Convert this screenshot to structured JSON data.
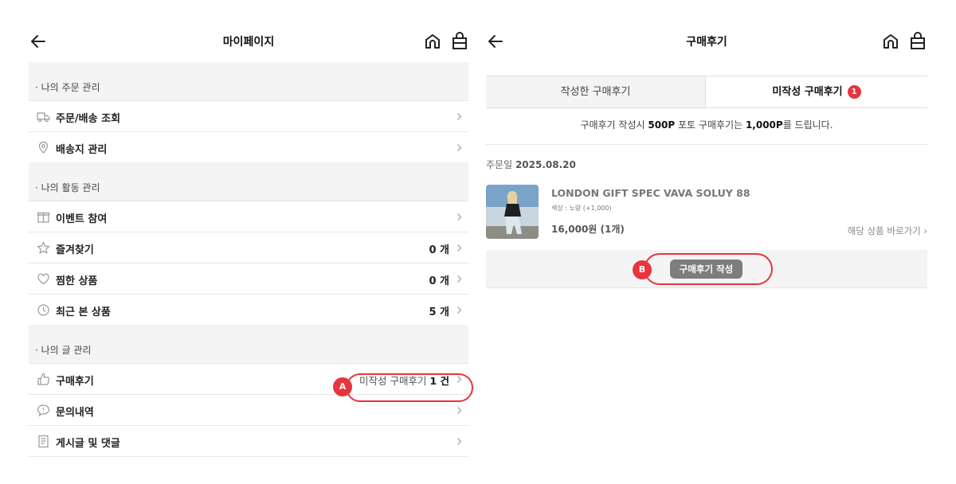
{
  "left_screen": {
    "title": "마이페이지",
    "sections": {
      "orders": {
        "heading": "· 나의 주문 관리",
        "items": [
          {
            "label": "주문/배송 조회",
            "icon": "truck-icon"
          },
          {
            "label": "배송지 관리",
            "icon": "location-pin-icon"
          }
        ]
      },
      "activity": {
        "heading": "· 나의 활동 관리",
        "items": [
          {
            "label": "이벤트 참여",
            "icon": "gift-icon"
          },
          {
            "label": "즐겨찾기",
            "icon": "star-icon",
            "value": "0 개"
          },
          {
            "label": "찜한 상품",
            "icon": "heart-icon",
            "value": "0 개"
          },
          {
            "label": "최근 본 상품",
            "icon": "clock-icon",
            "value": "5 개"
          }
        ]
      },
      "posts": {
        "heading": "· 나의 글 관리",
        "items": [
          {
            "label": "구매후기",
            "icon": "thumbs-up-icon",
            "pending_label": "미작성 구매후기",
            "pending_count": "1 건"
          },
          {
            "label": "문의내역",
            "icon": "speech-bubble-icon"
          },
          {
            "label": "게시글 및 댓글",
            "icon": "document-icon"
          }
        ]
      }
    },
    "callout_label": "A"
  },
  "right_screen": {
    "title": "구매후기",
    "tabs": {
      "written": "작성한 구매후기",
      "unwritten": "미작성 구매후기",
      "unwritten_count": "1"
    },
    "notice": {
      "part1": "구매후기 작성시 ",
      "point1": "500P",
      "part2": " 포토 구매후기는 ",
      "point2": "1,000P",
      "part3": "를 드립니다."
    },
    "order": {
      "date_label": "주문일 ",
      "date": "2025.08.20",
      "product_name": "LONDON GIFT SPEC VAVA SOLUY 88",
      "option": "색상 : 노랑 (+1,000)",
      "price": "16,000원 (1개)",
      "link": "해당 상품 바로가기"
    },
    "write_button": "구매후기 작성",
    "callout_label": "B"
  },
  "colors": {
    "accent_red": "#e8343d",
    "section_bg": "#f4f4f4",
    "button_gray": "#7d7d7d"
  }
}
